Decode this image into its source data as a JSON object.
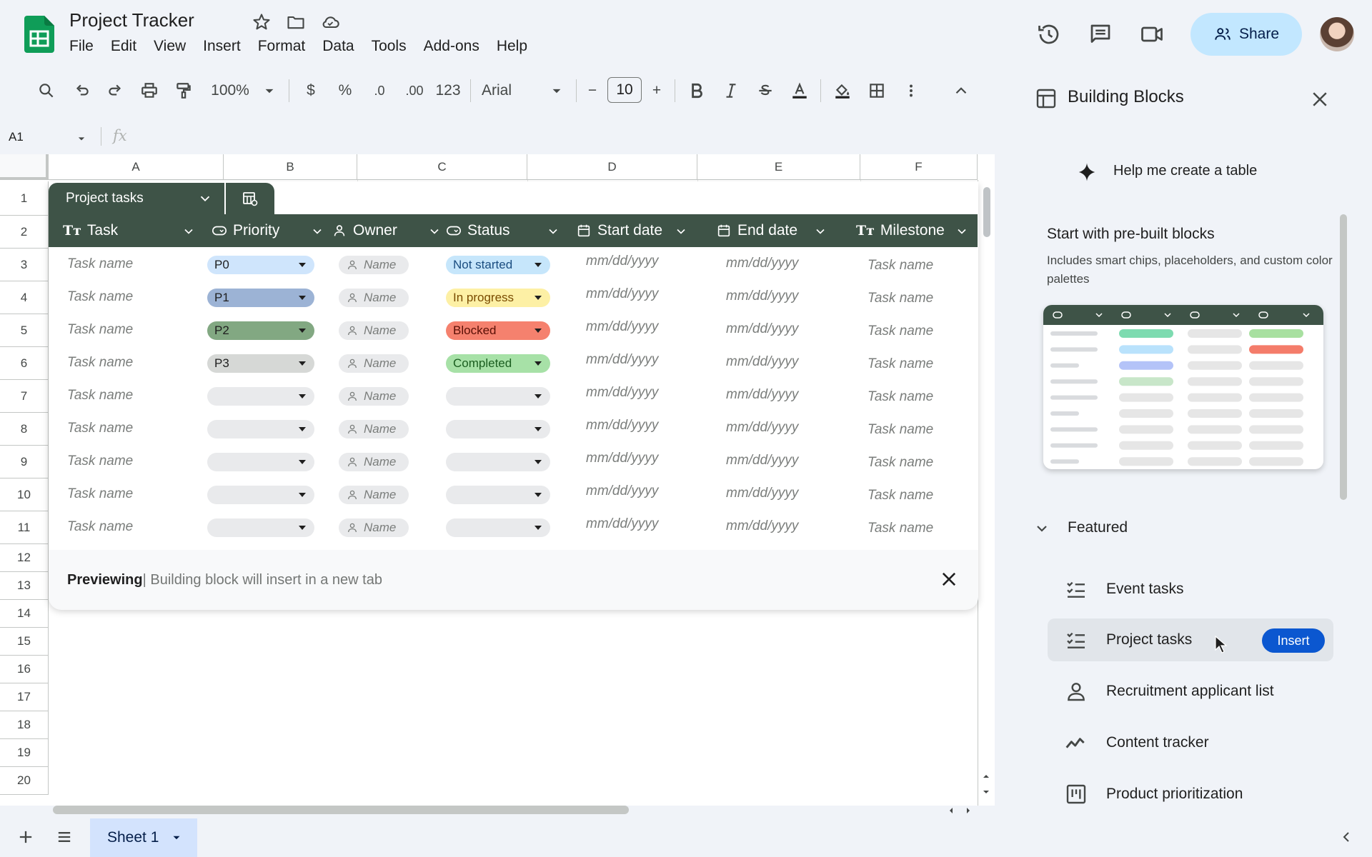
{
  "app": {
    "title": "Project Tracker",
    "menu": [
      "File",
      "Edit",
      "View",
      "Insert",
      "Format",
      "Data",
      "Tools",
      "Add-ons",
      "Help"
    ],
    "share_label": "Share"
  },
  "toolbar": {
    "zoom": "100%",
    "currency": "$",
    "percent": "%",
    "decrease_decimal": ".0",
    "increase_decimal": ".00",
    "number_format": "123",
    "font": "Arial",
    "font_size": "10",
    "minus": "−",
    "plus": "+"
  },
  "formula_bar": {
    "cell_ref": "A1",
    "fx": "fx"
  },
  "columns": [
    "A",
    "B",
    "C",
    "D",
    "E",
    "F"
  ],
  "rows": [
    "1",
    "2",
    "3",
    "4",
    "5",
    "6",
    "7",
    "8",
    "9",
    "10",
    "11",
    "12",
    "13",
    "14",
    "15",
    "16",
    "17",
    "18",
    "19",
    "20"
  ],
  "preview": {
    "tab_label": "Project tasks",
    "headers": [
      "Task",
      "Priority",
      "Owner",
      "Status",
      "Start date",
      "End date",
      "Milestone"
    ],
    "placeholder_task": "Task name",
    "placeholder_owner": "Name",
    "placeholder_date": "mm/dd/yyyy",
    "priorities": [
      {
        "label": "P0",
        "color": "#cfe5fc"
      },
      {
        "label": "P1",
        "color": "#9cb3d5"
      },
      {
        "label": "P2",
        "color": "#82a882"
      },
      {
        "label": "P3",
        "color": "#d6d8d6"
      }
    ],
    "statuses": [
      {
        "label": "Not started",
        "color": "#c6e6fb",
        "text": "#1a4d80"
      },
      {
        "label": "In progress",
        "color": "#fdf0a5",
        "text": "#7a4b00"
      },
      {
        "label": "Blocked",
        "color": "#f5816e",
        "text": "#5a1006"
      },
      {
        "label": "Completed",
        "color": "#a7e1a7",
        "text": "#1b5e20"
      }
    ],
    "bar_bold": "Previewing",
    "bar_text": " | Building block will insert in a new tab"
  },
  "sheet_tab": "Sheet 1",
  "panel": {
    "title": "Building Blocks",
    "help_create": "Help me create a table",
    "prebuilt_title": "Start with pre-built blocks",
    "prebuilt_desc": "Includes smart chips, placeholders, and custom color palettes",
    "featured_label": "Featured",
    "items": [
      {
        "label": "Event tasks",
        "icon": "checklist-icon"
      },
      {
        "label": "Project tasks",
        "icon": "checklist-icon"
      },
      {
        "label": "Recruitment applicant list",
        "icon": "person-icon"
      },
      {
        "label": "Content tracker",
        "icon": "trend-icon"
      },
      {
        "label": "Product prioritization",
        "icon": "kanban-icon"
      }
    ],
    "insert_label": "Insert"
  },
  "colors": {
    "header_green": "#3e5347",
    "share_bg": "#c2e7ff",
    "insert_blue": "#0b57d0",
    "sheets_green": "#0f9d58"
  }
}
